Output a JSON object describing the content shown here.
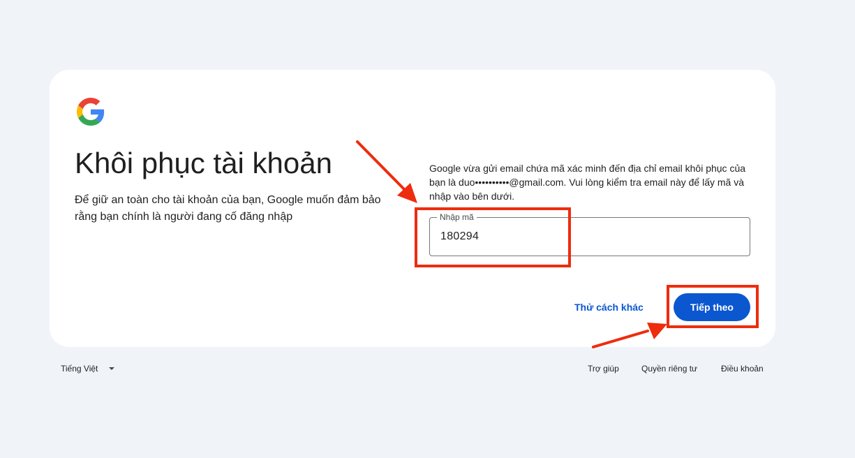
{
  "card": {
    "title": "Khôi phục tài khoản",
    "subtitle": "Để giữ an toàn cho tài khoản của bạn, Google muốn đảm bảo rằng bạn chính là người đang cố đăng nhập",
    "description": "Google vừa gửi email chứa mã xác minh đến địa chỉ email khôi phục của bạn là duo••••••••••@gmail.com. Vui lòng kiểm tra email này để lấy mã và nhập vào bên dưới."
  },
  "code_field": {
    "label": "Nhập mã",
    "value": "180294"
  },
  "actions": {
    "try_another_way": "Thử cách khác",
    "next": "Tiếp theo"
  },
  "footer": {
    "language": "Tiếng Việt",
    "help": "Trợ giúp",
    "privacy": "Quyền riêng tư",
    "terms": "Điều khoản"
  },
  "colors": {
    "background": "#f0f4f9",
    "primary": "#0b57d0",
    "annotation": "#ee2c0e"
  },
  "icons": {
    "logo": "google-g-logo",
    "language_dropdown": "caret-down"
  }
}
